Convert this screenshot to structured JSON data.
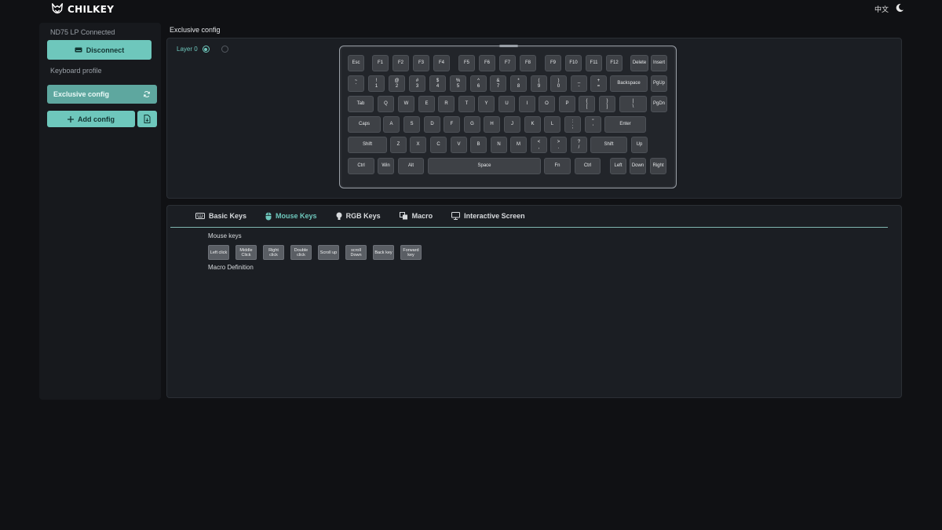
{
  "header": {
    "brand": "CHILKEY",
    "language": "中文",
    "theme_icon": "moon-icon"
  },
  "sidebar": {
    "device_status": "ND75 LP Connected",
    "disconnect_label": "Disconnect",
    "profile_section": "Keyboard profile",
    "profiles": [
      {
        "label": "Exclusive config"
      }
    ],
    "add_config_label": "Add config"
  },
  "main": {
    "section_title": "Exclusive config",
    "layer_label": "Layer 0"
  },
  "keyboard": {
    "rows": [
      [
        [
          "Esc"
        ],
        [
          "F1"
        ],
        [
          "F2"
        ],
        [
          "F3"
        ],
        [
          "F4"
        ],
        [
          "F5"
        ],
        [
          "F6"
        ],
        [
          "F7"
        ],
        [
          "F8"
        ],
        [
          "F9"
        ],
        [
          "F10"
        ],
        [
          "F11"
        ],
        [
          "F12"
        ],
        [
          "Delete"
        ],
        [
          "Insert"
        ]
      ],
      [
        [
          "~",
          "`"
        ],
        [
          "!",
          "1"
        ],
        [
          "@",
          "2"
        ],
        [
          "#",
          "3"
        ],
        [
          "$",
          "4"
        ],
        [
          "%",
          "5"
        ],
        [
          "^",
          "6"
        ],
        [
          "&",
          "7"
        ],
        [
          "*",
          "8"
        ],
        [
          "(",
          "9"
        ],
        [
          ")",
          "0"
        ],
        [
          "_",
          "-"
        ],
        [
          "+",
          "="
        ],
        [
          "Backspace"
        ],
        [
          "PgUp"
        ]
      ],
      [
        [
          "Tab"
        ],
        [
          "Q"
        ],
        [
          "W"
        ],
        [
          "E"
        ],
        [
          "R"
        ],
        [
          "T"
        ],
        [
          "Y"
        ],
        [
          "U"
        ],
        [
          "I"
        ],
        [
          "O"
        ],
        [
          "P"
        ],
        [
          "{",
          "["
        ],
        [
          "}",
          "]"
        ],
        [
          "|",
          "\\"
        ],
        [
          "PgDn"
        ]
      ],
      [
        [
          "Caps"
        ],
        [
          "A"
        ],
        [
          "S"
        ],
        [
          "D"
        ],
        [
          "F"
        ],
        [
          "G"
        ],
        [
          "H"
        ],
        [
          "J"
        ],
        [
          "K"
        ],
        [
          "L"
        ],
        [
          ":",
          ";"
        ],
        [
          "\"",
          "'"
        ],
        [
          "Enter"
        ]
      ],
      [
        [
          "Shift"
        ],
        [
          "Z"
        ],
        [
          "X"
        ],
        [
          "C"
        ],
        [
          "V"
        ],
        [
          "B"
        ],
        [
          "N"
        ],
        [
          "M"
        ],
        [
          "<",
          ","
        ],
        [
          ">",
          "."
        ],
        [
          "?",
          "/"
        ],
        [
          "Shift"
        ],
        [
          "Up"
        ]
      ],
      [
        [
          "Ctrl"
        ],
        [
          "Win"
        ],
        [
          "Alt"
        ],
        [
          "Space"
        ],
        [
          "Fn"
        ],
        [
          "Ctrl"
        ],
        [
          "Left"
        ],
        [
          "Down"
        ],
        [
          "Right"
        ]
      ]
    ]
  },
  "tabs": [
    {
      "label": "Basic Keys",
      "icon": "keyboard-icon"
    },
    {
      "label": "Mouse Keys",
      "icon": "mouse-icon"
    },
    {
      "label": "RGB Keys",
      "icon": "lightbulb-icon"
    },
    {
      "label": "Macro",
      "icon": "macro-icon"
    },
    {
      "label": "Interactive Screen",
      "icon": "monitor-icon"
    }
  ],
  "mouse_panel": {
    "title": "Mouse keys",
    "keys": [
      [
        "Left click"
      ],
      [
        "Middle",
        "Click"
      ],
      [
        "Right",
        "click"
      ],
      [
        "Double",
        "click"
      ],
      [
        "Scroll up"
      ],
      [
        "scroll",
        "Down"
      ],
      [
        "Back key"
      ],
      [
        "Forward",
        "key"
      ]
    ],
    "macro_title": "Macro Definition"
  },
  "colors": {
    "accent": "#6ec7bc",
    "background": "#101114",
    "panel": "#1b1e23"
  }
}
